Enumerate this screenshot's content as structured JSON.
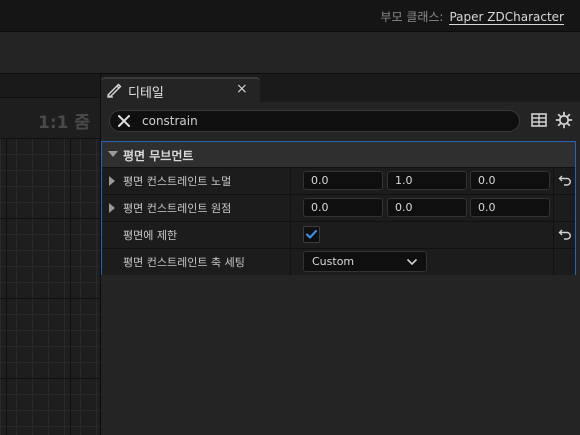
{
  "header": {
    "parent_class_label": "부모 클래스:",
    "parent_class_value": "Paper ZDCharacter"
  },
  "viewport": {
    "zoom_label": "1:1 줌"
  },
  "details_tab": {
    "icon": "pencil-icon",
    "title": "디테일",
    "close_glyph": "×"
  },
  "search": {
    "value": "constrain",
    "clear_icon": "close-icon",
    "table_icon": "table-icon",
    "settings_icon": "gear-icon"
  },
  "category": {
    "title": "평면 무브먼트"
  },
  "properties": {
    "plane_normal": {
      "label": "평면 컨스트레인트 노멀",
      "values": [
        "0.0",
        "1.0",
        "0.0"
      ]
    },
    "plane_origin": {
      "label": "평면 컨스트레인트 원점",
      "values": [
        "0.0",
        "0.0",
        "0.0"
      ]
    },
    "constrain_to_plane": {
      "label": "평면에 제한",
      "checked": true
    },
    "axis_setting": {
      "label": "평면 컨스트레인트 축 세팅",
      "value": "Custom"
    }
  },
  "colors": {
    "accent": "#2a63b8",
    "check": "#3a8ee6"
  }
}
